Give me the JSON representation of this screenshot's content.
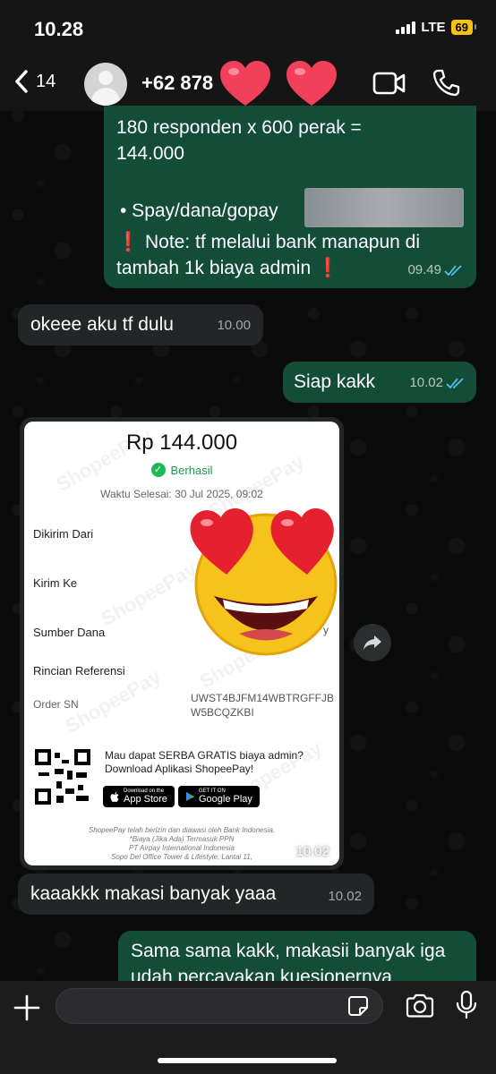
{
  "status_bar": {
    "time": "10.28",
    "network": "LTE",
    "battery": "69"
  },
  "header": {
    "back_count": "14",
    "contact_name": "+62 878",
    "icons": [
      "chevron-left-icon",
      "avatar-placeholder-icon",
      "video-icon",
      "phone-icon"
    ]
  },
  "messages": [
    {
      "direction": "outgoing",
      "lines": [
        "180 responden  x 600 perak =",
        "144.000",
        "•  Spay/dana/gopay",
        "❗ Note: tf melalui bank manapun di",
        "tambah 1k biaya admin ❗"
      ],
      "time": "09.49",
      "read": true
    },
    {
      "direction": "incoming",
      "text": "okeee aku tf dulu",
      "time": "10.00"
    },
    {
      "direction": "outgoing",
      "text": "Siap kakk",
      "time": "10.02",
      "read": true
    },
    {
      "direction": "incoming",
      "type": "image",
      "time": "10.02",
      "receipt": {
        "amount": "Rp 144.000",
        "status": "Berhasil",
        "completed_time": "Waktu Selesai: 30 Jul 2025, 09:02",
        "labels": [
          "Dikirim Dari",
          "Kirim Ke",
          "Sumber Dana",
          "Rincian Referensi"
        ],
        "source_fragment": "y",
        "order_label": "Order SN",
        "order_value": "UWST4BJFM14WBTRGFFJB W5BCQZKBI",
        "promo_line1": "Mau dapat SERBA GRATIS biaya admin?",
        "promo_line2": "Download Aplikasi ShopeePay!",
        "app_store_small": "Download on the",
        "app_store": "App Store",
        "google_play_small": "GET IT ON",
        "google_play": "Google Play",
        "footer_line1": "ShopeePay telah berizin dan diawasi oleh Bank Indonesia.",
        "footer_line2": "*Biaya (Jika Ada) Termasuk PPN",
        "footer_line3": "PT Airpay International Indonesia",
        "footer_line4": "Sopo Del Office Tower & Lifestyle, Lantai 11,",
        "watermark": "ShopeePay"
      }
    },
    {
      "direction": "incoming",
      "text": "kaaakkk makasi banyak yaaa",
      "time": "10.02"
    },
    {
      "direction": "outgoing",
      "text": "Sama sama kakk, makasii banyak iga udah percayakan kuesionernya"
    }
  ],
  "composer": {
    "value": "",
    "placeholder": ""
  },
  "colors": {
    "outgoing_bubble": "#144d37",
    "incoming_bubble": "#232626",
    "read_ticks": "#53bdeb",
    "battery": "#f4c20d"
  }
}
